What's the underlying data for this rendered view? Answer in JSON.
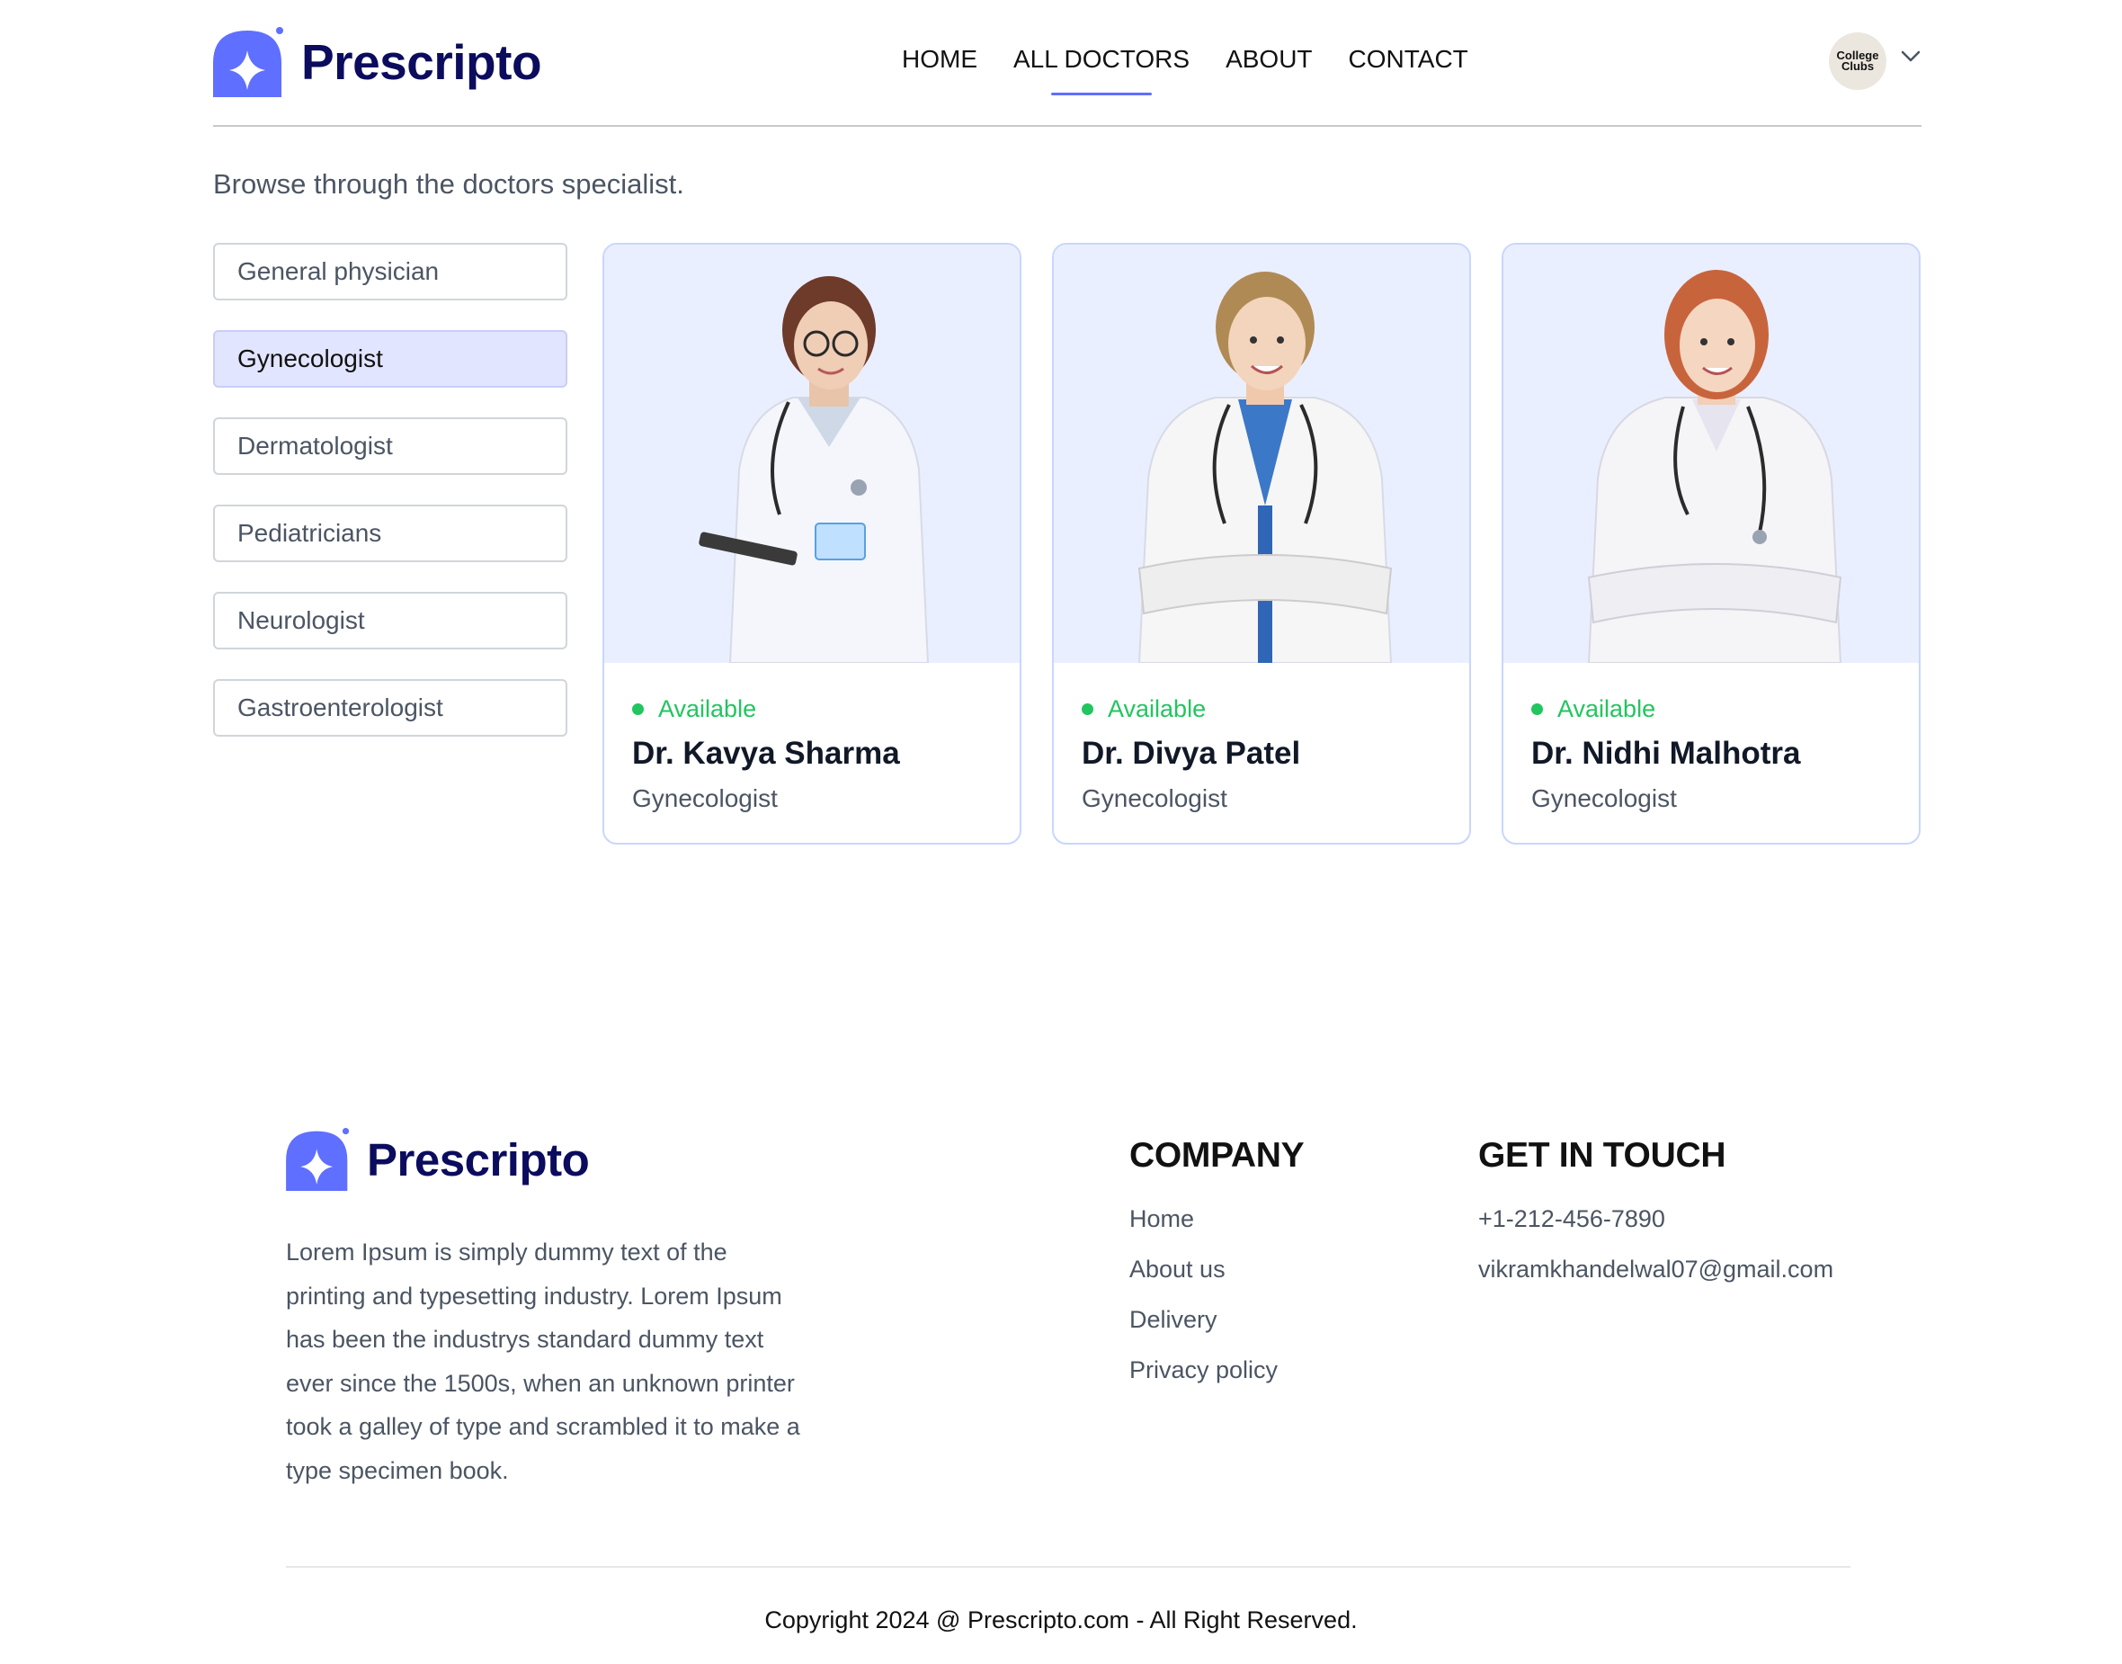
{
  "brand": {
    "name": "Prescripto",
    "accent": "#5f6fff",
    "navy": "#0b0c5e"
  },
  "nav": {
    "links": [
      "HOME",
      "ALL DOCTORS",
      "ABOUT",
      "CONTACT"
    ],
    "active_index": 1,
    "avatar_text": "College Clubs",
    "dropdown_icon": "chevron-down-icon"
  },
  "page": {
    "subtitle": "Browse through the doctors specialist."
  },
  "specialities": {
    "items": [
      "General physician",
      "Gynecologist",
      "Dermatologist",
      "Pediatricians",
      "Neurologist",
      "Gastroenterologist"
    ],
    "selected": "Gynecologist"
  },
  "doctors": [
    {
      "status": "Available",
      "name": "Dr. Kavya Sharma",
      "speciality": "Gynecologist"
    },
    {
      "status": "Available",
      "name": "Dr. Divya Patel",
      "speciality": "Gynecologist"
    },
    {
      "status": "Available",
      "name": "Dr. Nidhi Malhotra",
      "speciality": "Gynecologist"
    }
  ],
  "footer": {
    "brand": "Prescripto",
    "description": "Lorem Ipsum is simply dummy text of the printing and typesetting industry. Lorem Ipsum has been the industrys standard dummy text ever since the 1500s, when an unknown printer took a galley of type and scrambled it to make a type specimen book.",
    "company": {
      "heading": "COMPANY",
      "links": [
        "Home",
        "About us",
        "Delivery",
        "Privacy policy"
      ]
    },
    "contact": {
      "heading": "GET IN TOUCH",
      "phone": "+1-212-456-7890",
      "email": "vikramkhandelwal07@gmail.com"
    },
    "copyright": "Copyright 2024 @ Prescripto.com - All Right Reserved."
  }
}
